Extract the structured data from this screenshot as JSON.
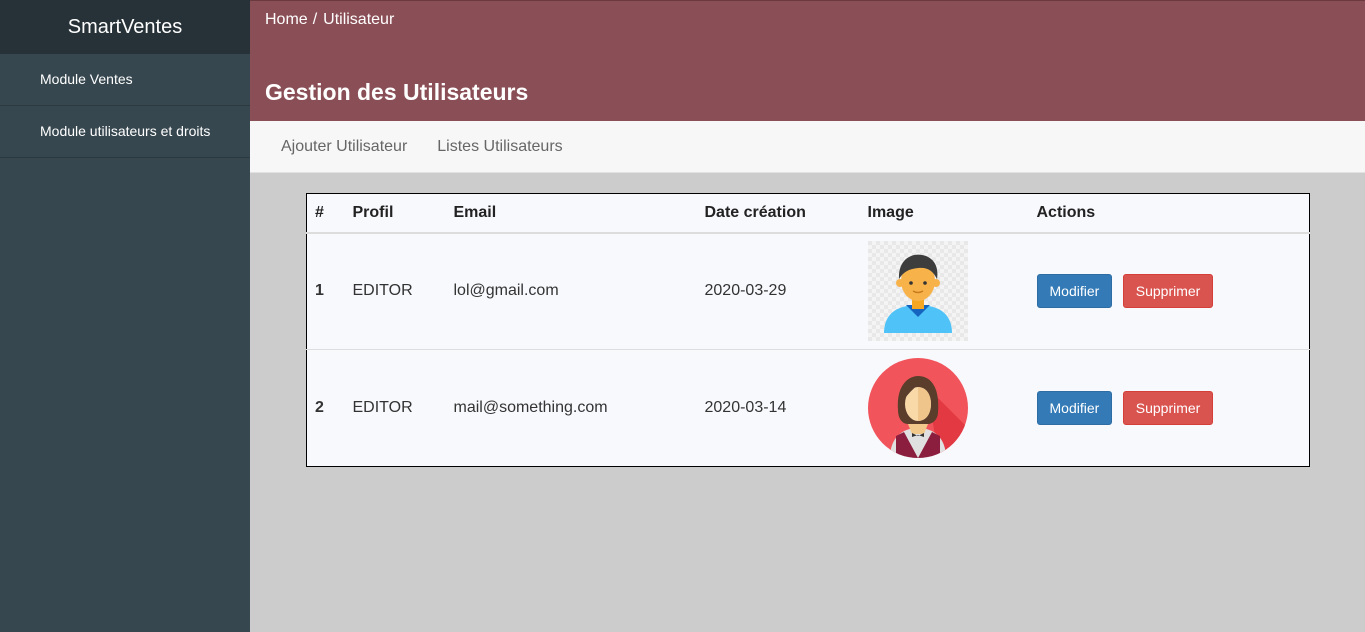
{
  "app": {
    "brand": "SmartVentes"
  },
  "sidebar": {
    "items": [
      {
        "label": "Module Ventes"
      },
      {
        "label": "Module utilisateurs et droits"
      }
    ]
  },
  "breadcrumb": {
    "home": "Home",
    "separator": "/",
    "current": "Utilisateur"
  },
  "page": {
    "title": "Gestion des Utilisateurs"
  },
  "tabs": [
    {
      "label": "Ajouter Utilisateur"
    },
    {
      "label": "Listes Utilisateurs"
    }
  ],
  "table": {
    "headers": [
      "#",
      "Profil",
      "Email",
      "Date création",
      "Image",
      "Actions"
    ],
    "rows": [
      {
        "index": "1",
        "profil": "EDITOR",
        "email": "lol@gmail.com",
        "date": "2020-03-29",
        "image_icon": "male-user-avatar-icon",
        "edit_label": "Modifier",
        "delete_label": "Supprimer"
      },
      {
        "index": "2",
        "profil": "EDITOR",
        "email": "mail@something.com",
        "date": "2020-03-14",
        "image_icon": "female-waiter-avatar-icon",
        "edit_label": "Modifier",
        "delete_label": "Supprimer"
      }
    ]
  },
  "colors": {
    "sidebar_bg": "#37474f",
    "brand_bg": "#263238",
    "header_bg": "#8a4f56",
    "edit_button": "#337ab7",
    "delete_button": "#d9534f",
    "content_bg": "#cccccc"
  }
}
